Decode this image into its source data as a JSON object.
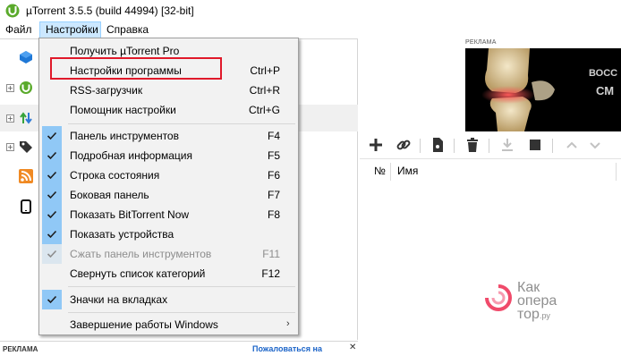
{
  "window": {
    "title": "µTorrent 3.5.5  (build 44994) [32-bit]"
  },
  "menubar": {
    "items": [
      {
        "label": "Файл"
      },
      {
        "label": "Настройки"
      },
      {
        "label": "Справка"
      }
    ]
  },
  "dropdown": {
    "items": [
      {
        "label": "Получить µTorrent Pro",
        "shortcut": ""
      },
      {
        "label": "Настройки программы",
        "shortcut": "Ctrl+P"
      },
      {
        "label": "RSS-загрузчик",
        "shortcut": "Ctrl+R"
      },
      {
        "label": "Помощник настройки",
        "shortcut": "Ctrl+G"
      },
      {
        "label": "Панель инструментов",
        "shortcut": "F4",
        "checked": true
      },
      {
        "label": "Подробная информация",
        "shortcut": "F5",
        "checked": true
      },
      {
        "label": "Строка состояния",
        "shortcut": "F6",
        "checked": true
      },
      {
        "label": "Боковая панель",
        "shortcut": "F7",
        "checked": true
      },
      {
        "label": "Показать BitTorrent Now",
        "shortcut": "F8",
        "checked": true
      },
      {
        "label": "Показать устройства",
        "shortcut": "",
        "checked": true
      },
      {
        "label": "Сжать панель инструментов",
        "shortcut": "F11",
        "checked": true,
        "disabled": true
      },
      {
        "label": "Свернуть список категорий",
        "shortcut": "F12"
      },
      {
        "label": "Значки на вкладках",
        "shortcut": "",
        "checked": true
      },
      {
        "label": "Завершение работы Windows",
        "shortcut": "",
        "submenu": true
      }
    ]
  },
  "ad": {
    "top_label": "РЕКЛАМА",
    "banner_text_1": "ВОСС",
    "banner_text_2": "СМ"
  },
  "list": {
    "columns": [
      {
        "label": "№"
      },
      {
        "label": "Имя"
      }
    ]
  },
  "watermark": {
    "line1": "Как",
    "line2": "опера",
    "line3": "тор",
    "suffix": ".ру"
  },
  "bottom": {
    "ad_label": "РЕКЛАМА",
    "complain_label": "Пожаловаться на",
    "close_label": "✕"
  },
  "colors": {
    "highlight_box": "#e0192a",
    "check_bg": "#90c8f6",
    "menu_active": "#cce8ff",
    "link": "#1b64c8"
  }
}
